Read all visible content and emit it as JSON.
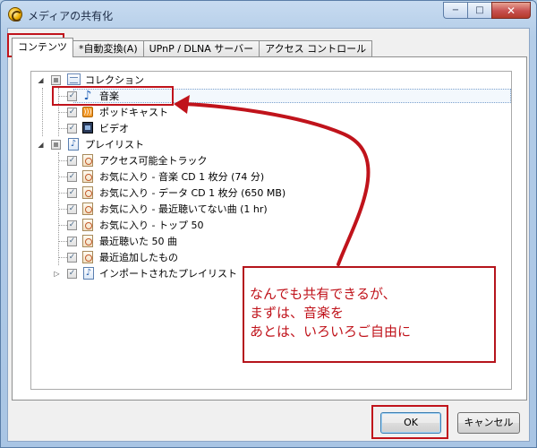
{
  "window": {
    "title": "メディアの共有化",
    "minimize_glyph": "−",
    "maximize_glyph": "□",
    "close_glyph": "✕"
  },
  "tabs": [
    {
      "label": "コンテンツ",
      "active": true
    },
    {
      "label": "*自動変換(A)",
      "active": false
    },
    {
      "label": "UPnP / DLNA サーバー",
      "active": false
    },
    {
      "label": "アクセス コントロール",
      "active": false
    }
  ],
  "tree": {
    "collection": {
      "label": "コレクション",
      "children": [
        {
          "label": "音楽",
          "icon": "music-note-icon"
        },
        {
          "label": "ポッドキャスト",
          "icon": "podcast-icon"
        },
        {
          "label": "ビデオ",
          "icon": "video-icon"
        }
      ]
    },
    "playlists": {
      "label": "プレイリスト",
      "children": [
        {
          "label": "アクセス可能全トラック"
        },
        {
          "label": "お気に入り - 音楽 CD 1 枚分 (74 分)"
        },
        {
          "label": "お気に入り - データ CD 1 枚分 (650 MB)"
        },
        {
          "label": "お気に入り - 最近聴いてない曲 (1 hr)"
        },
        {
          "label": "お気に入り - トップ 50"
        },
        {
          "label": "最近聴いた 50 曲"
        },
        {
          "label": "最近追加したもの"
        },
        {
          "label": "インポートされたプレイリスト"
        }
      ]
    },
    "expanded_glyph": "◢",
    "collapsed_glyph": "▷",
    "check_glyph": "✓"
  },
  "annotation": {
    "lines": [
      "なんでも共有できるが、",
      "まずは、音楽を",
      "あとは、いろいろご自由に"
    ],
    "color": "#c0131b"
  },
  "buttons": {
    "ok": "OK",
    "cancel": "キャンセル"
  }
}
